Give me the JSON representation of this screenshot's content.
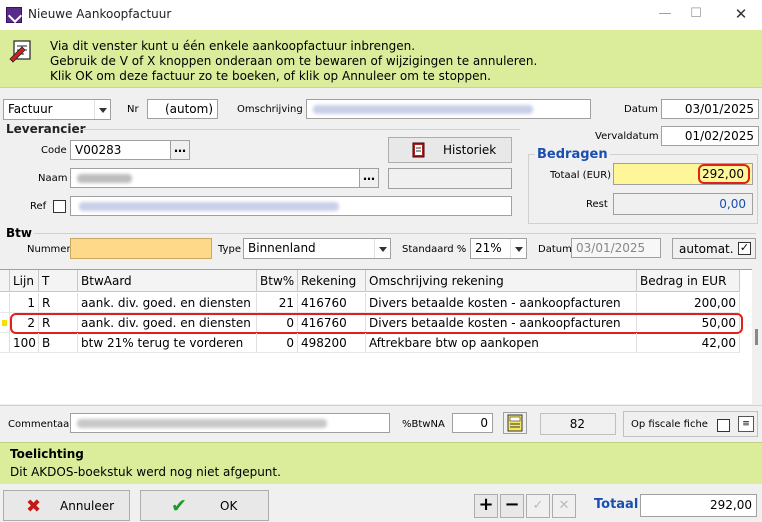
{
  "window": {
    "title": "Nieuwe Aankoopfactuur"
  },
  "info": {
    "line1": "Via dit venster kunt u één enkele aankoopfactuur inbrengen.",
    "line2": "Gebruik de V of X knoppen onderaan om te bewaren of wijzigingen te annuleren.",
    "line3": "Klik OK om deze factuur zo te boeken, of klik op Annuleer om te stoppen."
  },
  "header": {
    "doctype": "Factuur",
    "nr_label": "Nr",
    "nr_value": "(autom)",
    "omschrijving_label": "Omschrijving",
    "datum_label": "Datum",
    "datum_value": "03/01/2025",
    "vervaldatum_label": "Vervaldatum",
    "vervaldatum_value": "01/02/2025"
  },
  "leverancier": {
    "title": "Leverancier",
    "code_label": "Code",
    "code_value": "V00283",
    "naam_label": "Naam",
    "ref_label": "Ref",
    "historiek_label": "Historiek"
  },
  "bedragen": {
    "title": "Bedragen",
    "totaal_label": "Totaal (EUR)",
    "totaal_value": "292,00",
    "rest_label": "Rest",
    "rest_value": "0,00"
  },
  "btw": {
    "title": "Btw",
    "nummer_label": "Nummer",
    "type_label": "Type",
    "type_value": "Binnenland",
    "standaard_label": "Standaard %",
    "standaard_value": "21%",
    "datum_label": "Datum",
    "datum_value": "03/01/2025",
    "automat_label": "automat.",
    "automat_checked": true
  },
  "table": {
    "columns": [
      "Lijn",
      "T",
      "BtwAard",
      "Btw%",
      "Rekening",
      "Omschrijving rekening",
      "Bedrag in EUR"
    ],
    "rows": [
      {
        "lijn": "1",
        "t": "R",
        "btwaard": "aank. div. goed. en diensten",
        "btw": "21",
        "rekening": "416760",
        "omschrijving": "Divers betaalde kosten - aankoopfacturen",
        "bedrag": "200,00"
      },
      {
        "lijn": "2",
        "t": "R",
        "btwaard": "aank. div. goed. en diensten",
        "btw": "0",
        "rekening": "416760",
        "omschrijving": "Divers betaalde kosten - aankoopfacturen",
        "bedrag": "50,00"
      },
      {
        "lijn": "100",
        "t": "B",
        "btwaard": "btw 21% terug te vorderen",
        "btw": "0",
        "rekening": "498200",
        "omschrijving": "Aftrekbare btw op aankopen",
        "bedrag": "42,00"
      }
    ]
  },
  "footer": {
    "commentaar_label": "Commentaar",
    "btwna_label": "%BtwNA",
    "btwna_value": "0",
    "count_value": "82",
    "fiscale_label": "Op fiscale fiche"
  },
  "toelichting": {
    "title": "Toelichting",
    "text": "Dit AKDOS-boekstuk werd nog niet afgepunt."
  },
  "bottom": {
    "annuleer_label": "Annuleer",
    "ok_label": "OK",
    "totaal_label": "Totaal",
    "totaal_value": "292,00"
  },
  "colors": {
    "info_bg": "#dbed9b",
    "highlight_yellow": "#fff69a",
    "accent_blue": "#1a4fb0",
    "ring_red": "#e0201a",
    "btw_nummer_bg": "#ffd98a"
  }
}
